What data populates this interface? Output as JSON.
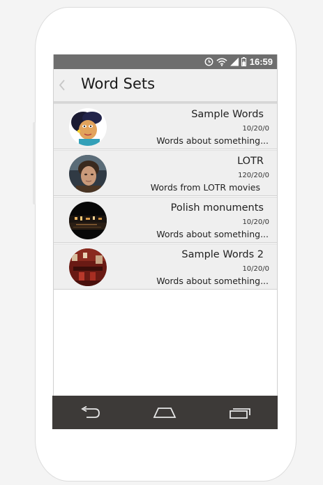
{
  "status_bar": {
    "time": "16:59",
    "icons": [
      "alarm-clock-icon",
      "wifi-icon",
      "signal-icon",
      "battery-charging-icon"
    ]
  },
  "app_bar": {
    "title": "Word Sets",
    "back_icon": "chevron-left-icon"
  },
  "word_sets": [
    {
      "title": "Sample Words",
      "stats": "10/20/0",
      "description": "Words about something...",
      "avatar": "cartoon-princess-avatar"
    },
    {
      "title": "LOTR",
      "stats": "120/20/0",
      "description": "Words from LOTR movies",
      "avatar": "movie-character-avatar"
    },
    {
      "title": "Polish monuments",
      "stats": "10/20/0",
      "description": "Words about something...",
      "avatar": "night-city-avatar"
    },
    {
      "title": "Sample Words 2",
      "stats": "10/20/0",
      "description": "Words about something...",
      "avatar": "red-interior-avatar"
    }
  ],
  "nav_bar": {
    "buttons": [
      "back-icon",
      "home-icon",
      "recent-apps-icon"
    ]
  },
  "colors": {
    "status_bar": "#6e6e6e",
    "app_bar": "#f0f0f0",
    "row_background": "#efefef",
    "nav_bar": "#3d3a38"
  }
}
